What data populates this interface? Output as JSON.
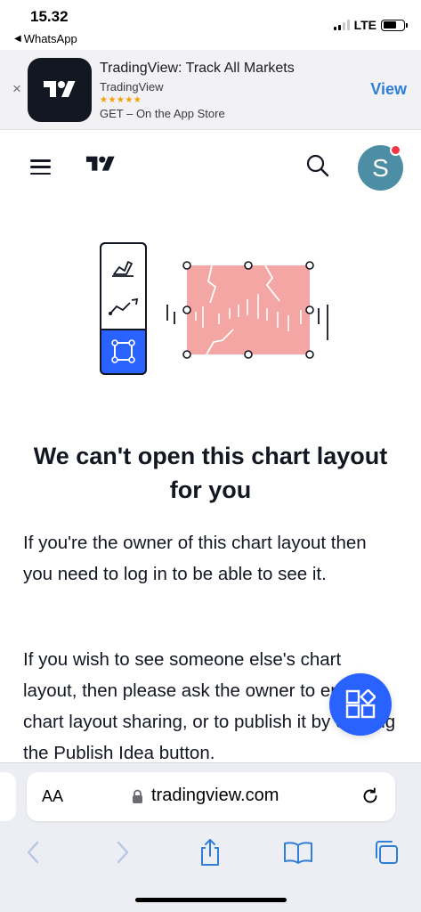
{
  "status_bar": {
    "time": "15.32",
    "back_app": "WhatsApp",
    "network": "LTE"
  },
  "app_banner": {
    "close_glyph": "×",
    "title": "TradingView: Track All Markets",
    "developer": "TradingView",
    "stars": "★★★★★",
    "rating_stars": 5,
    "get_text": "GET – On the App Store",
    "view_label": "View"
  },
  "header": {
    "avatar_letter": "S",
    "notification_dot_color": "#f23645"
  },
  "content": {
    "title": "We can't open this chart layout for you",
    "paragraph1": "If you're the owner of this chart layout then you need to log in to be able to see it.",
    "paragraph2": "If you wish to see someone else's chart layout, then please ask the owner to enable chart layout sharing, or to publish it by clicking the Publish Idea button."
  },
  "safari": {
    "aa_label": "AA",
    "url": "tradingview.com"
  },
  "colors": {
    "accent": "#2962ff",
    "banner_view": "#2f7ed8",
    "illustration_fill": "#f4a6a4",
    "avatar_bg": "#4e8ea5"
  }
}
